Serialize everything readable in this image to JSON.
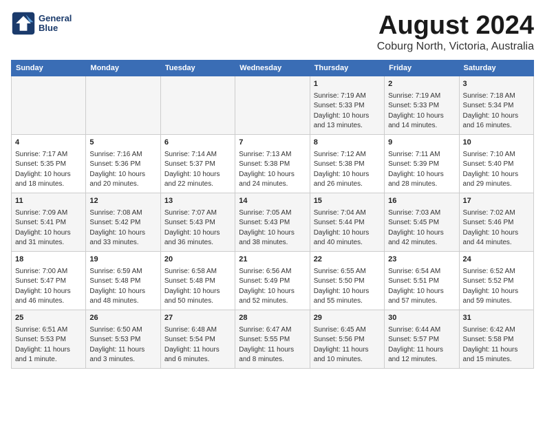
{
  "header": {
    "logo_line1": "General",
    "logo_line2": "Blue",
    "title": "August 2024",
    "subtitle": "Coburg North, Victoria, Australia"
  },
  "weekdays": [
    "Sunday",
    "Monday",
    "Tuesday",
    "Wednesday",
    "Thursday",
    "Friday",
    "Saturday"
  ],
  "weeks": [
    [
      {
        "day": "",
        "info": ""
      },
      {
        "day": "",
        "info": ""
      },
      {
        "day": "",
        "info": ""
      },
      {
        "day": "",
        "info": ""
      },
      {
        "day": "1",
        "info": "Sunrise: 7:19 AM\nSunset: 5:33 PM\nDaylight: 10 hours\nand 13 minutes."
      },
      {
        "day": "2",
        "info": "Sunrise: 7:19 AM\nSunset: 5:33 PM\nDaylight: 10 hours\nand 14 minutes."
      },
      {
        "day": "3",
        "info": "Sunrise: 7:18 AM\nSunset: 5:34 PM\nDaylight: 10 hours\nand 16 minutes."
      }
    ],
    [
      {
        "day": "4",
        "info": "Sunrise: 7:17 AM\nSunset: 5:35 PM\nDaylight: 10 hours\nand 18 minutes."
      },
      {
        "day": "5",
        "info": "Sunrise: 7:16 AM\nSunset: 5:36 PM\nDaylight: 10 hours\nand 20 minutes."
      },
      {
        "day": "6",
        "info": "Sunrise: 7:14 AM\nSunset: 5:37 PM\nDaylight: 10 hours\nand 22 minutes."
      },
      {
        "day": "7",
        "info": "Sunrise: 7:13 AM\nSunset: 5:38 PM\nDaylight: 10 hours\nand 24 minutes."
      },
      {
        "day": "8",
        "info": "Sunrise: 7:12 AM\nSunset: 5:38 PM\nDaylight: 10 hours\nand 26 minutes."
      },
      {
        "day": "9",
        "info": "Sunrise: 7:11 AM\nSunset: 5:39 PM\nDaylight: 10 hours\nand 28 minutes."
      },
      {
        "day": "10",
        "info": "Sunrise: 7:10 AM\nSunset: 5:40 PM\nDaylight: 10 hours\nand 29 minutes."
      }
    ],
    [
      {
        "day": "11",
        "info": "Sunrise: 7:09 AM\nSunset: 5:41 PM\nDaylight: 10 hours\nand 31 minutes."
      },
      {
        "day": "12",
        "info": "Sunrise: 7:08 AM\nSunset: 5:42 PM\nDaylight: 10 hours\nand 33 minutes."
      },
      {
        "day": "13",
        "info": "Sunrise: 7:07 AM\nSunset: 5:43 PM\nDaylight: 10 hours\nand 36 minutes."
      },
      {
        "day": "14",
        "info": "Sunrise: 7:05 AM\nSunset: 5:43 PM\nDaylight: 10 hours\nand 38 minutes."
      },
      {
        "day": "15",
        "info": "Sunrise: 7:04 AM\nSunset: 5:44 PM\nDaylight: 10 hours\nand 40 minutes."
      },
      {
        "day": "16",
        "info": "Sunrise: 7:03 AM\nSunset: 5:45 PM\nDaylight: 10 hours\nand 42 minutes."
      },
      {
        "day": "17",
        "info": "Sunrise: 7:02 AM\nSunset: 5:46 PM\nDaylight: 10 hours\nand 44 minutes."
      }
    ],
    [
      {
        "day": "18",
        "info": "Sunrise: 7:00 AM\nSunset: 5:47 PM\nDaylight: 10 hours\nand 46 minutes."
      },
      {
        "day": "19",
        "info": "Sunrise: 6:59 AM\nSunset: 5:48 PM\nDaylight: 10 hours\nand 48 minutes."
      },
      {
        "day": "20",
        "info": "Sunrise: 6:58 AM\nSunset: 5:48 PM\nDaylight: 10 hours\nand 50 minutes."
      },
      {
        "day": "21",
        "info": "Sunrise: 6:56 AM\nSunset: 5:49 PM\nDaylight: 10 hours\nand 52 minutes."
      },
      {
        "day": "22",
        "info": "Sunrise: 6:55 AM\nSunset: 5:50 PM\nDaylight: 10 hours\nand 55 minutes."
      },
      {
        "day": "23",
        "info": "Sunrise: 6:54 AM\nSunset: 5:51 PM\nDaylight: 10 hours\nand 57 minutes."
      },
      {
        "day": "24",
        "info": "Sunrise: 6:52 AM\nSunset: 5:52 PM\nDaylight: 10 hours\nand 59 minutes."
      }
    ],
    [
      {
        "day": "25",
        "info": "Sunrise: 6:51 AM\nSunset: 5:53 PM\nDaylight: 11 hours\nand 1 minute."
      },
      {
        "day": "26",
        "info": "Sunrise: 6:50 AM\nSunset: 5:53 PM\nDaylight: 11 hours\nand 3 minutes."
      },
      {
        "day": "27",
        "info": "Sunrise: 6:48 AM\nSunset: 5:54 PM\nDaylight: 11 hours\nand 6 minutes."
      },
      {
        "day": "28",
        "info": "Sunrise: 6:47 AM\nSunset: 5:55 PM\nDaylight: 11 hours\nand 8 minutes."
      },
      {
        "day": "29",
        "info": "Sunrise: 6:45 AM\nSunset: 5:56 PM\nDaylight: 11 hours\nand 10 minutes."
      },
      {
        "day": "30",
        "info": "Sunrise: 6:44 AM\nSunset: 5:57 PM\nDaylight: 11 hours\nand 12 minutes."
      },
      {
        "day": "31",
        "info": "Sunrise: 6:42 AM\nSunset: 5:58 PM\nDaylight: 11 hours\nand 15 minutes."
      }
    ]
  ]
}
